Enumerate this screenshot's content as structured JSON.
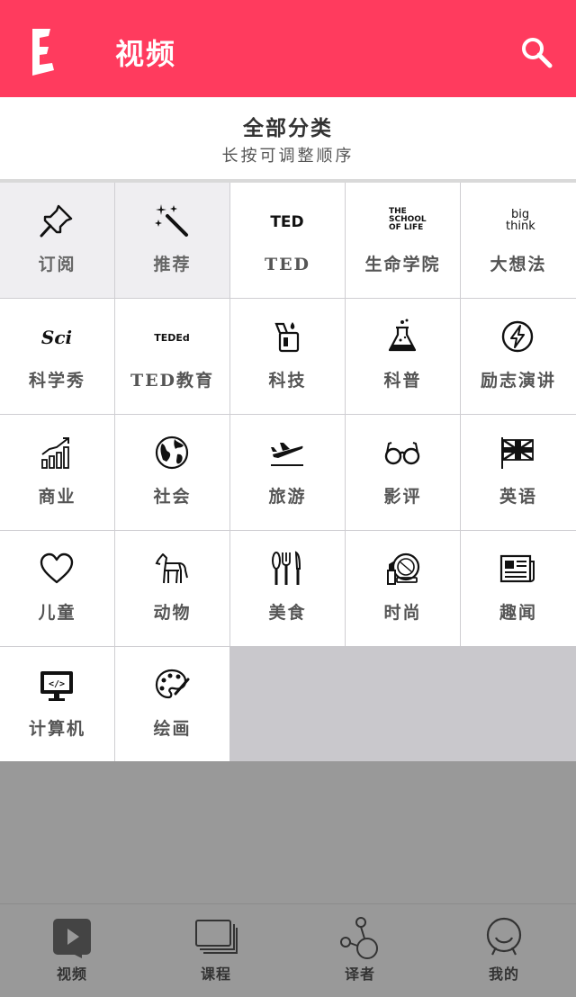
{
  "header": {
    "title": "视频",
    "logo_letter": "E",
    "brand_color": "#FF3B5E"
  },
  "section": {
    "title": "全部分类",
    "subtitle": "长按可调整顺序"
  },
  "categories": [
    {
      "label": "订阅",
      "icon": "pushpin-icon",
      "selected": true
    },
    {
      "label": "推荐",
      "icon": "magic-wand-icon",
      "selected": true
    },
    {
      "label": "TED",
      "icon": "ted-logo-icon",
      "logo_text": "TED"
    },
    {
      "label": "生命学院",
      "icon": "school-of-life-logo-icon",
      "logo_text": [
        "THE",
        "SCHOOL",
        "OF LIFE"
      ]
    },
    {
      "label": "大想法",
      "icon": "big-think-logo-icon",
      "logo_text": [
        "big",
        "think"
      ]
    },
    {
      "label": "科学秀",
      "icon": "sci-logo-icon",
      "logo_text": "Sci"
    },
    {
      "label": "TED教育",
      "icon": "teded-logo-icon",
      "logo_text": "TEDEd"
    },
    {
      "label": "科技",
      "icon": "lighter-icon"
    },
    {
      "label": "科普",
      "icon": "flask-icon"
    },
    {
      "label": "励志演讲",
      "icon": "lightning-icon"
    },
    {
      "label": "商业",
      "icon": "growth-chart-icon"
    },
    {
      "label": "社会",
      "icon": "globe-icon"
    },
    {
      "label": "旅游",
      "icon": "airplane-icon"
    },
    {
      "label": "影评",
      "icon": "glasses-icon"
    },
    {
      "label": "英语",
      "icon": "uk-flag-icon"
    },
    {
      "label": "儿童",
      "icon": "heart-icon"
    },
    {
      "label": "动物",
      "icon": "horse-icon"
    },
    {
      "label": "美食",
      "icon": "cutlery-icon"
    },
    {
      "label": "时尚",
      "icon": "makeup-icon"
    },
    {
      "label": "趣闻",
      "icon": "newspaper-icon"
    },
    {
      "label": "计算机",
      "icon": "computer-code-icon",
      "logo_text": "</>"
    },
    {
      "label": "绘画",
      "icon": "palette-icon"
    }
  ],
  "tabs": [
    {
      "label": "视频",
      "icon": "video-icon",
      "active": true
    },
    {
      "label": "课程",
      "icon": "course-stack-icon"
    },
    {
      "label": "译者",
      "icon": "translator-network-icon"
    },
    {
      "label": "我的",
      "icon": "profile-face-icon"
    }
  ]
}
